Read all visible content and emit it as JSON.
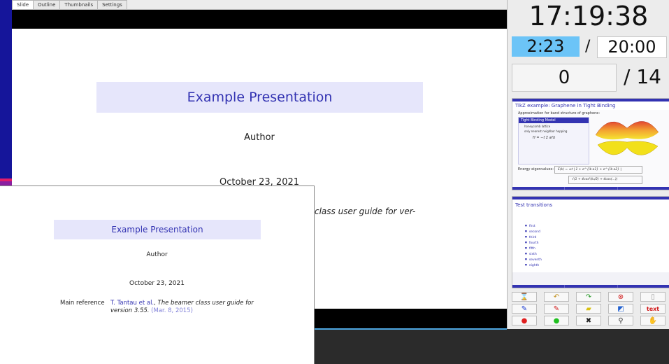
{
  "tabs": [
    "Slide",
    "Outline",
    "Thumbnails",
    "Settings"
  ],
  "slide": {
    "title": "Example Presentation",
    "author": "Author",
    "date": "October 23, 2021",
    "ref_partial": "class user guide for ver-"
  },
  "overlay": {
    "title": "Example Presentation",
    "author": "Author",
    "date": "October 23, 2021",
    "ref_key": "Main reference",
    "ref_author": "T. Tantau et al.",
    "ref_title": "The beamer class user guide for version 3.55.",
    "ref_date": "(Mar. 8, 2015)"
  },
  "timer": {
    "clock": "17:19:38",
    "elapsed": "2:23",
    "slash": "/",
    "total": "20:00",
    "page": "0",
    "page_total": "/ 14"
  },
  "thumb1": {
    "title": "TikZ example: Graphene in Tight Binding",
    "subtitle": "Approximation for band structure of graphene:",
    "block_title": "Tight Binding Model",
    "bullets": [
      "honeycomb lattice",
      "only nearest neighbor hopping"
    ],
    "energy_label": "Energy eigenvalues:"
  },
  "thumb2": {
    "title": "Test transitions",
    "items": [
      "first",
      "second",
      "third",
      "fourth",
      "fifth",
      "sixth",
      "seventh",
      "eighth"
    ]
  },
  "tools": [
    {
      "name": "hourglass-icon",
      "glyph": "⌛",
      "color": "#b07a10"
    },
    {
      "name": "undo-icon",
      "glyph": "↶",
      "color": "#c09020"
    },
    {
      "name": "redo-icon",
      "glyph": "↷",
      "color": "#2a9a2a"
    },
    {
      "name": "clear-icon",
      "glyph": "⊗",
      "color": "#d02020"
    },
    {
      "name": "blank-icon",
      "glyph": "▯",
      "color": "#999999"
    },
    {
      "name": "blue-pen-icon",
      "glyph": "✎",
      "color": "#1a3ad0"
    },
    {
      "name": "red-pen-icon",
      "glyph": "✎",
      "color": "#d01a1a"
    },
    {
      "name": "highlighter-icon",
      "glyph": "▰",
      "color": "#d8c010"
    },
    {
      "name": "eraser-icon",
      "glyph": "◩",
      "color": "#2060d0"
    },
    {
      "name": "text-icon",
      "glyph": "text",
      "color": "#d01a1a"
    },
    {
      "name": "red-pointer-icon",
      "glyph": "●",
      "color": "#e02020"
    },
    {
      "name": "green-pointer-icon",
      "glyph": "●",
      "color": "#20c020"
    },
    {
      "name": "pin-icon",
      "glyph": "✖",
      "color": "#222222"
    },
    {
      "name": "magnifier-icon",
      "glyph": "⚲",
      "color": "#333333"
    },
    {
      "name": "hand-icon",
      "glyph": "✋",
      "color": "#333333"
    }
  ]
}
